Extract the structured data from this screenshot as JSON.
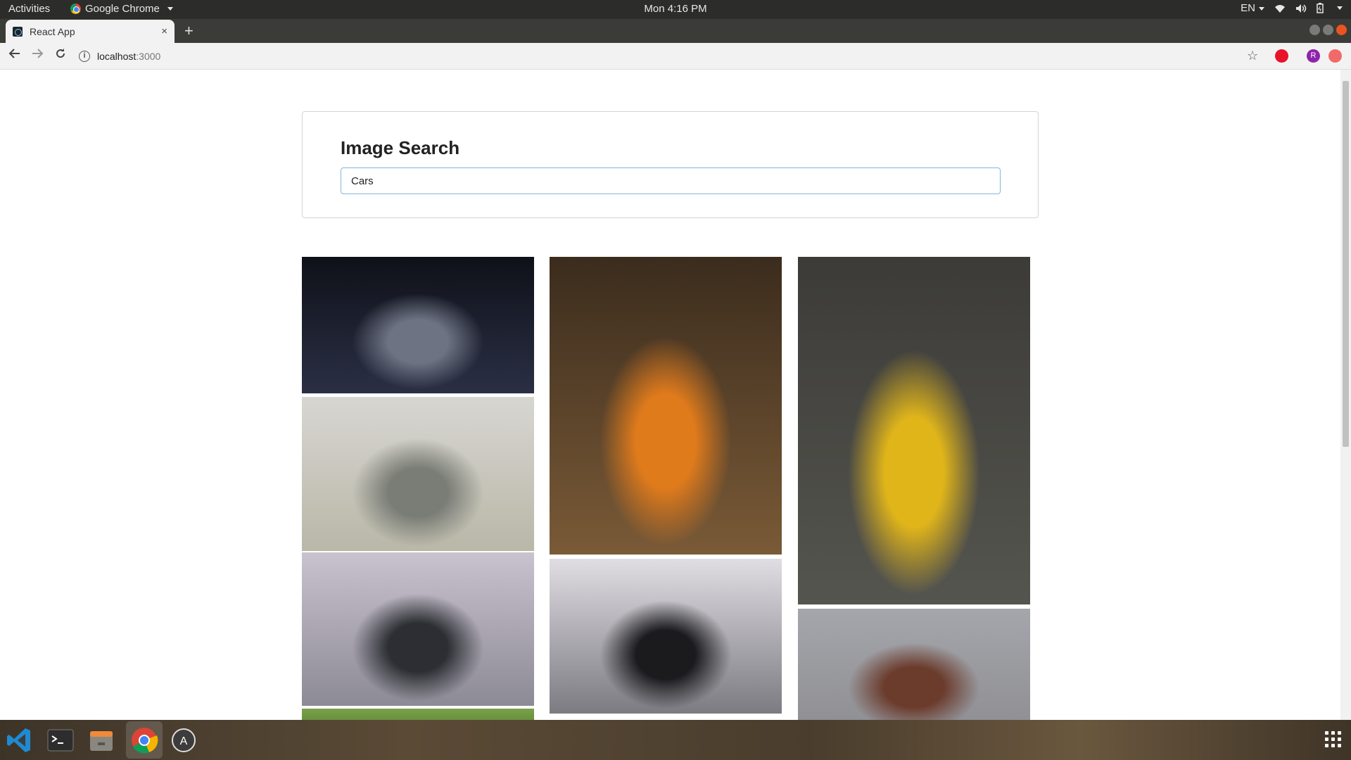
{
  "topbar": {
    "activities": "Activities",
    "app_name": "Google Chrome",
    "clock": "Mon  4:16 PM",
    "lang": "EN"
  },
  "browser": {
    "tab_title": "React App",
    "tab_close": "×",
    "new_tab": "+",
    "url_host": "localhost",
    "url_port": ":3000",
    "profile_initial": "R"
  },
  "page": {
    "heading": "Image Search",
    "search_value": "Cars"
  },
  "images": [
    {
      "alt": "white sports car in dark garage",
      "colors": [
        "#0f1119",
        "#2a2f44",
        "#6e7384"
      ]
    },
    {
      "alt": "row of vintage cars in white garage",
      "colors": [
        "#d7d6d2",
        "#b9b7a7",
        "#7a7d76"
      ]
    },
    {
      "alt": "black muscle car under cloudy sky",
      "colors": [
        "#c9c2cf",
        "#8c8a94",
        "#2c2e33"
      ]
    },
    {
      "alt": "green foliage",
      "colors": [
        "#7aa14a",
        "#4f7a2e"
      ]
    },
    {
      "alt": "orange supercar in forest",
      "colors": [
        "#3b2c1d",
        "#7a5a37",
        "#e07b1c"
      ]
    },
    {
      "alt": "black sedan driving on road",
      "colors": [
        "#e0dde3",
        "#7c7b82",
        "#1b1b1e"
      ]
    },
    {
      "alt": "grey car with yellow stripe",
      "colors": [
        "#3c3b38",
        "#55554f",
        "#e0b51a"
      ]
    },
    {
      "alt": "grey sky with rocks",
      "colors": [
        "#a5a6ab",
        "#8d8d92",
        "#6b3b2c"
      ]
    }
  ],
  "colors": {
    "accent": "#85b7d9",
    "card_border": "#d4d4d5",
    "dock_highlight": "#e95420"
  },
  "dock": {
    "apps": [
      "vscode-icon",
      "terminal-icon",
      "files-icon",
      "chrome-icon",
      "software-updater-icon"
    ]
  }
}
